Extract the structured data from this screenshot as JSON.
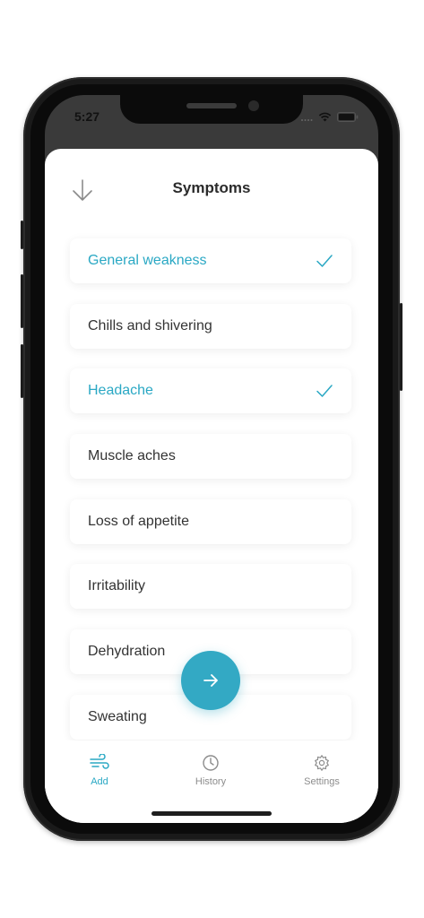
{
  "status_bar": {
    "time": "5:27"
  },
  "header": {
    "title": "Symptoms"
  },
  "symptoms": [
    {
      "label": "General weakness",
      "selected": true
    },
    {
      "label": "Chills and shivering",
      "selected": false
    },
    {
      "label": "Headache",
      "selected": true
    },
    {
      "label": "Muscle aches",
      "selected": false
    },
    {
      "label": "Loss of appetite",
      "selected": false
    },
    {
      "label": "Irritability",
      "selected": false
    },
    {
      "label": "Dehydration",
      "selected": false
    },
    {
      "label": "Sweating",
      "selected": false
    }
  ],
  "fab": {
    "icon": "arrow-right-icon"
  },
  "tabs": [
    {
      "label": "Add",
      "icon": "wind-icon",
      "active": true
    },
    {
      "label": "History",
      "icon": "clock-icon",
      "active": false
    },
    {
      "label": "Settings",
      "icon": "gear-icon",
      "active": false
    }
  ],
  "colors": {
    "accent": "#33a9c4",
    "text": "#333333",
    "muted": "#8c8c8c"
  }
}
